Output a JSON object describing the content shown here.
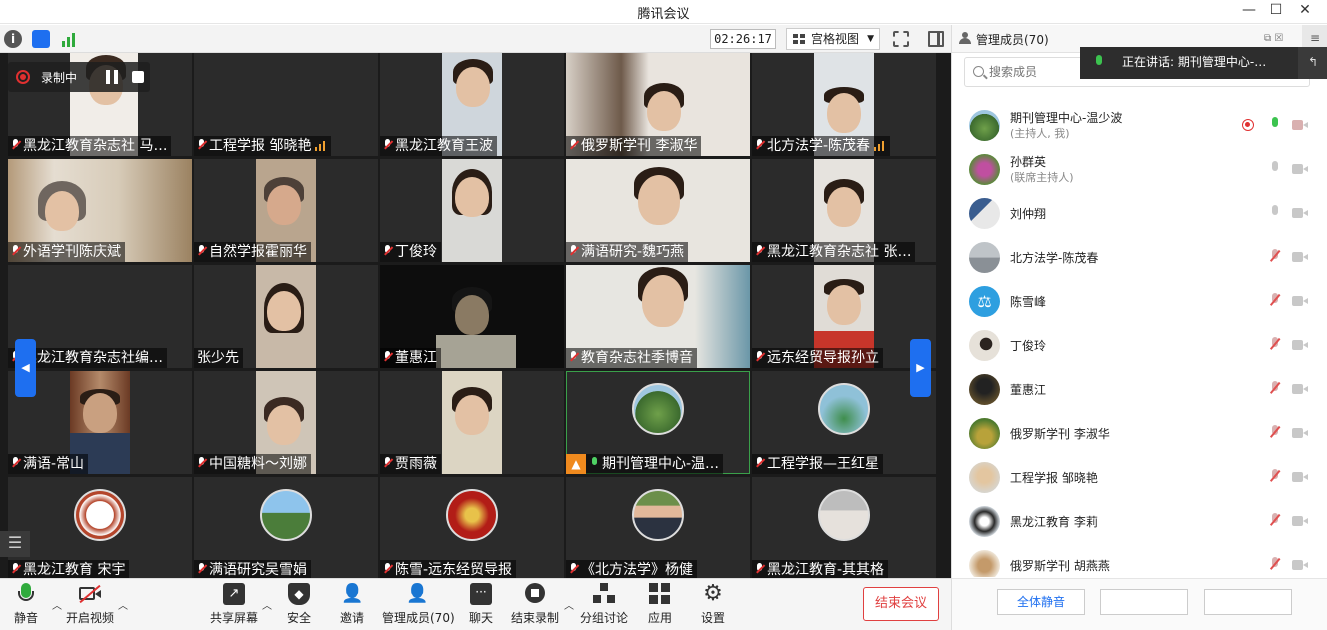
{
  "window": {
    "title": "腾讯会议",
    "controls": [
      "—",
      "☐",
      "✕"
    ]
  },
  "topbar": {
    "timer": "02:26:17",
    "view_label": "宫格视图"
  },
  "recording": {
    "label": "录制中"
  },
  "tiles": [
    {
      "name": "黑龙江教育杂志社 马…",
      "muted": true
    },
    {
      "name": "工程学报 邹晓艳",
      "muted": true,
      "signal": true
    },
    {
      "name": "黑龙江教育王波",
      "muted": true
    },
    {
      "name": "俄罗斯学刊 李淑华",
      "muted": true
    },
    {
      "name": "北方法学-陈茂春",
      "muted": true,
      "signal": true
    },
    {
      "name": "外语学刊陈庆斌",
      "muted": true
    },
    {
      "name": "自然学报霍丽华",
      "muted": true
    },
    {
      "name": "丁俊玲",
      "muted": true
    },
    {
      "name": "满语研究-魏巧燕",
      "muted": true
    },
    {
      "name": "黑龙江教育杂志社 张…",
      "muted": true
    },
    {
      "name": "黑龙江教育杂志社编…",
      "muted": true
    },
    {
      "name": "张少先",
      "muted": false,
      "nomic": true
    },
    {
      "name": "董惠江",
      "muted": true
    },
    {
      "name": "教育杂志社季博音",
      "muted": true
    },
    {
      "name": "远东经贸导报孙立",
      "muted": true
    },
    {
      "name": "满语-常山",
      "muted": true
    },
    {
      "name": "中国糖料～刘娜",
      "muted": true
    },
    {
      "name": "贾雨薇",
      "muted": true
    },
    {
      "name": "期刊管理中心-温…",
      "muted": false,
      "active": true
    },
    {
      "name": "工程学报—王红星",
      "muted": true
    },
    {
      "name": "黑龙江教育 宋宇",
      "muted": true
    },
    {
      "name": "满语研究吴雪娟",
      "muted": true
    },
    {
      "name": "陈雪-远东经贸导报",
      "muted": true
    },
    {
      "name": "《北方法学》杨健",
      "muted": true
    },
    {
      "name": "黑龙江教育-其其格",
      "muted": true
    }
  ],
  "toolbar": {
    "mute": "静音",
    "video": "开启视频",
    "share": "共享屏幕",
    "security": "安全",
    "invite": "邀请",
    "members": "管理成员(70)",
    "chat": "聊天",
    "end_record": "结束录制",
    "breakout": "分组讨论",
    "apps": "应用",
    "settings": "设置",
    "end_meeting": "结束会议"
  },
  "panel": {
    "title": "管理成员(70)",
    "search_placeholder": "搜索成员",
    "members": [
      {
        "name": "期刊管理中心-温少波",
        "role": "(主持人, 我)",
        "recording": true,
        "mic": "live",
        "cam": "off"
      },
      {
        "name": "孙群英",
        "role": "(联席主持人)",
        "mic": "idle",
        "cam": "idle"
      },
      {
        "name": "刘仲翔",
        "mic": "idle",
        "cam": "idle"
      },
      {
        "name": "北方法学-陈茂春",
        "mic": "muted",
        "cam": "idle"
      },
      {
        "name": "陈雪峰",
        "mic": "muted",
        "cam": "idle"
      },
      {
        "name": "丁俊玲",
        "mic": "muted",
        "cam": "idle"
      },
      {
        "name": "董惠江",
        "mic": "muted",
        "cam": "idle"
      },
      {
        "name": "俄罗斯学刊 李淑华",
        "mic": "muted",
        "cam": "idle"
      },
      {
        "name": "工程学报 邹晓艳",
        "mic": "muted",
        "cam": "idle"
      },
      {
        "name": "黑龙江教育 李莉",
        "mic": "muted",
        "cam": "idle"
      },
      {
        "name": "俄罗斯学刊 胡燕燕",
        "mic": "muted",
        "cam": "idle"
      }
    ],
    "mute_all": "全体静音",
    "speaking": "正在讲话: 期刊管理中心-…"
  },
  "colors": {
    "accent": "#1e6ff0",
    "end_red": "#e04040",
    "speaking_green": "#3cc34f"
  }
}
